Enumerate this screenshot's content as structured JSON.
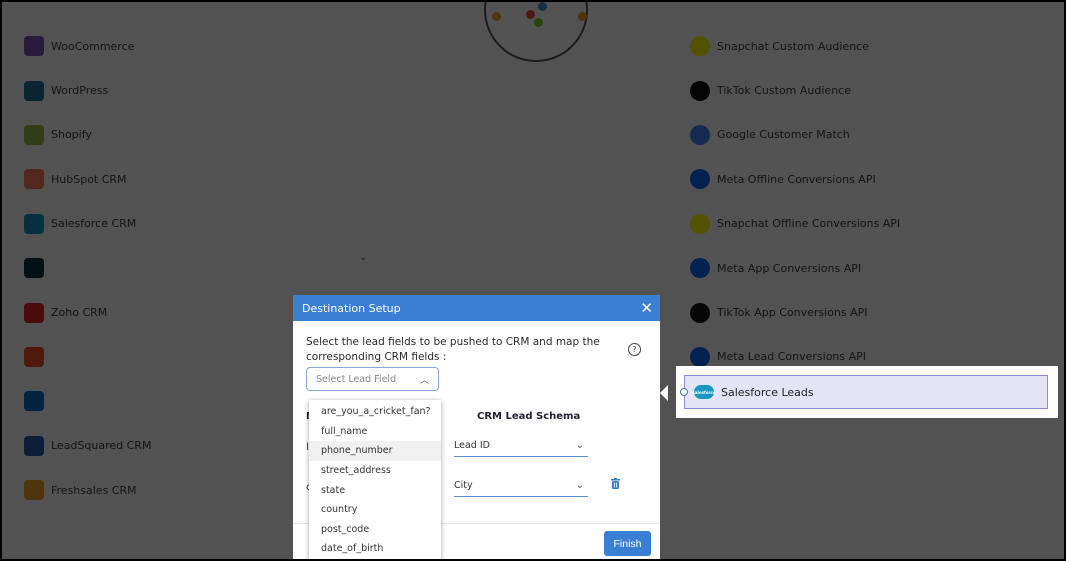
{
  "sources": [
    {
      "name": "WooCommerce",
      "icon": "woocommerce-icon",
      "color": "#7f54b3"
    },
    {
      "name": "WordPress",
      "icon": "wordpress-icon",
      "color": "#21759b"
    },
    {
      "name": "Shopify",
      "icon": "shopify-icon",
      "color": "#95bf47"
    },
    {
      "name": "HubSpot CRM",
      "icon": "hubspot-icon",
      "color": "#ff7a59"
    },
    {
      "name": "Salesforce CRM",
      "icon": "salesforce-icon",
      "color": "#1798c1"
    },
    {
      "name": "",
      "icon": "zendesk-icon",
      "color": "#03363d"
    },
    {
      "name": "Zoho CRM",
      "icon": "zoho-icon",
      "color": "#e42527"
    },
    {
      "name": "",
      "icon": "microsoft-icon",
      "color": "#f25022"
    },
    {
      "name": "",
      "icon": "sap-icon",
      "color": "#0a6ed1"
    },
    {
      "name": "LeadSquared CRM",
      "icon": "leadsquared-icon",
      "color": "#2a5caa"
    },
    {
      "name": "Freshsales CRM",
      "icon": "freshsales-icon",
      "color": "#f5a623"
    }
  ],
  "destinations": [
    {
      "name": "Snapchat Custom Audience",
      "icon": "snapchat-icon",
      "color": "#fffc00"
    },
    {
      "name": "TikTok Custom Audience",
      "icon": "tiktok-icon",
      "color": "#111111"
    },
    {
      "name": "Google Customer Match",
      "icon": "google-ads-icon",
      "color": "#4285f4"
    },
    {
      "name": "Meta Offline Conversions API",
      "icon": "meta-icon",
      "color": "#0866ff"
    },
    {
      "name": "Snapchat Offline Conversions API",
      "icon": "snapchat-icon",
      "color": "#fffc00"
    },
    {
      "name": "Meta App Conversions API",
      "icon": "meta-icon",
      "color": "#0866ff"
    },
    {
      "name": "TikTok App Conversions API",
      "icon": "tiktok-icon",
      "color": "#111111"
    },
    {
      "name": "Meta Lead Conversions API",
      "icon": "meta-icon",
      "color": "#0866ff"
    }
  ],
  "highlighted_destination": {
    "name": "Salesforce Leads",
    "logo_text": "salesforce"
  },
  "modal": {
    "title": "Destination Setup",
    "close_glyph": "✕",
    "instruction": "Select the lead fields to be pushed to CRM and map the corresponding CRM fields :",
    "help_glyph": "?",
    "select_placeholder": "Select Lead Field",
    "left_column_header": "M",
    "column_header": "CRM Lead Schema",
    "row1_left": "l",
    "row2_left": "c",
    "rows": [
      {
        "crm_field": "Lead ID"
      },
      {
        "crm_field": "City"
      }
    ],
    "finish_label": "Finish"
  },
  "dropdown_options": [
    "are_you_a_cricket_fan?",
    "full_name",
    "phone_number",
    "street_address",
    "state",
    "country",
    "post_code",
    "date_of_birth"
  ],
  "hovered_option": "phone_number",
  "colors": {
    "accent": "#3b7fd4",
    "overlay": "rgba(0,0,0,0.68)",
    "highlight_card": "#e4e4f6",
    "trash": "#3b7fd4"
  }
}
